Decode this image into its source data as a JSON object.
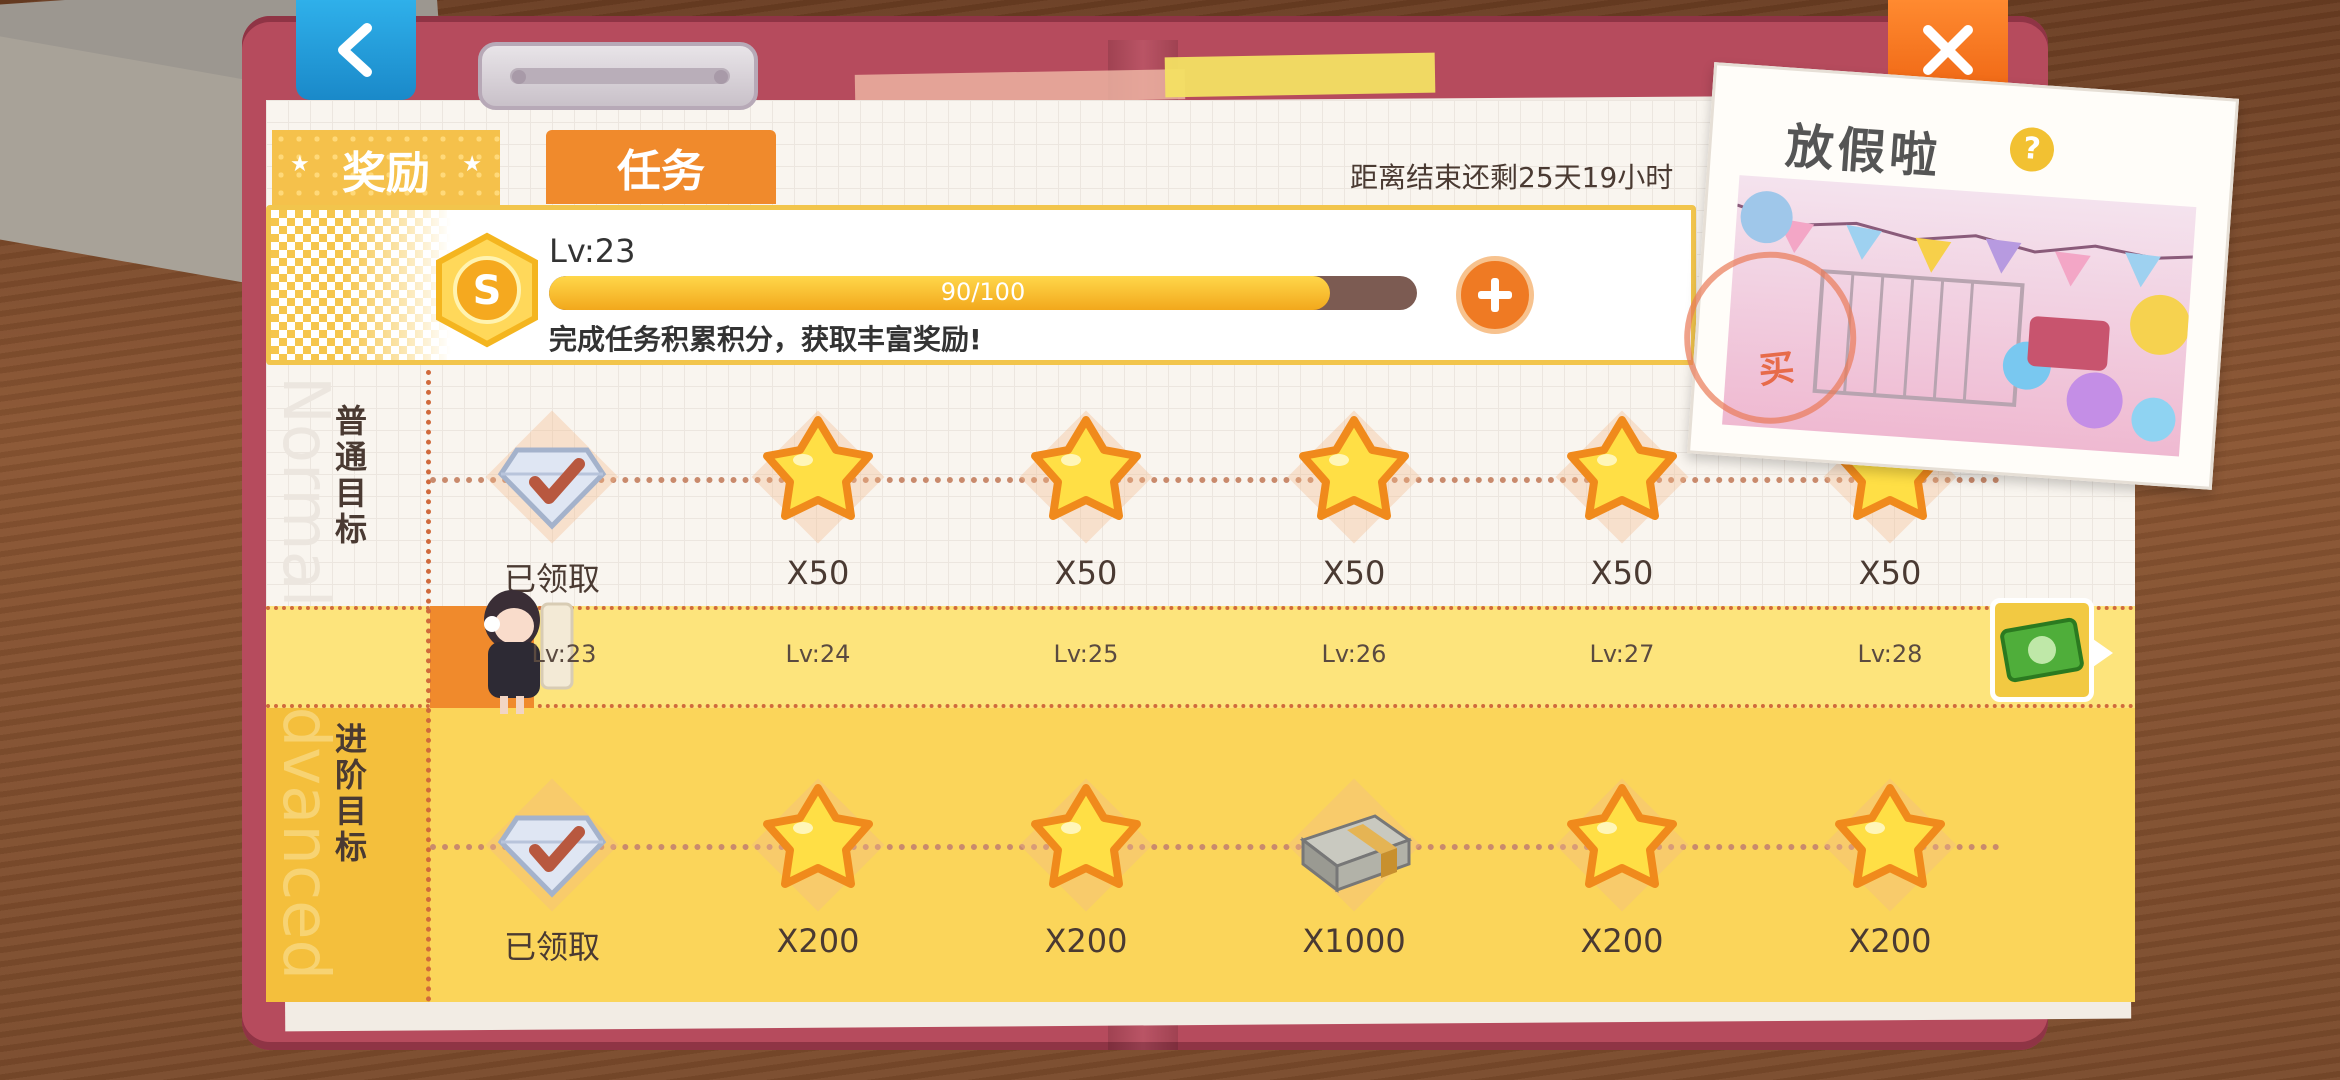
{
  "nav": {
    "back_icon": "chevron-left-icon",
    "close_icon": "close-x-icon"
  },
  "tabs": [
    {
      "label": "奖励",
      "active": true
    },
    {
      "label": "任务",
      "active": false
    }
  ],
  "countdown": "距离结束还剩25天19小时",
  "level": {
    "label": "Lv:23",
    "progress_text": "90/100",
    "progress_current": 90,
    "progress_max": 100,
    "description": "完成任务积累积分，获取丰富奖励!"
  },
  "rows": {
    "normal": {
      "label_cn": "普通目标",
      "label_en": "Normal"
    },
    "advanced": {
      "label_cn": "进阶目标",
      "label_en": "Advanced"
    }
  },
  "levels": [
    "Lv:23",
    "Lv:24",
    "Lv:25",
    "Lv:26",
    "Lv:27",
    "Lv:28"
  ],
  "normal_rewards": [
    {
      "icon": "diamond-icon",
      "label": "已领取",
      "claimed": true
    },
    {
      "icon": "star-icon",
      "label": "X50"
    },
    {
      "icon": "star-icon",
      "label": "X50"
    },
    {
      "icon": "star-icon",
      "label": "X50"
    },
    {
      "icon": "star-icon",
      "label": "X50"
    },
    {
      "icon": "star-icon",
      "label": "X50"
    }
  ],
  "advanced_rewards": [
    {
      "icon": "diamond-icon",
      "label": "已领取",
      "claimed": true
    },
    {
      "icon": "star-icon",
      "label": "X200"
    },
    {
      "icon": "star-icon",
      "label": "X200"
    },
    {
      "icon": "cash-stack-icon",
      "label": "X1000"
    },
    {
      "icon": "star-icon",
      "label": "X200"
    },
    {
      "icon": "star-icon",
      "label": "X200"
    }
  ],
  "event_card": {
    "title": "放假啦",
    "help": "?",
    "stamp": "买"
  },
  "colors": {
    "accent_orange": "#f08a2c",
    "accent_yellow": "#f5c14b",
    "folder": "#b64b5d",
    "back_blue": "#1a89c9"
  }
}
